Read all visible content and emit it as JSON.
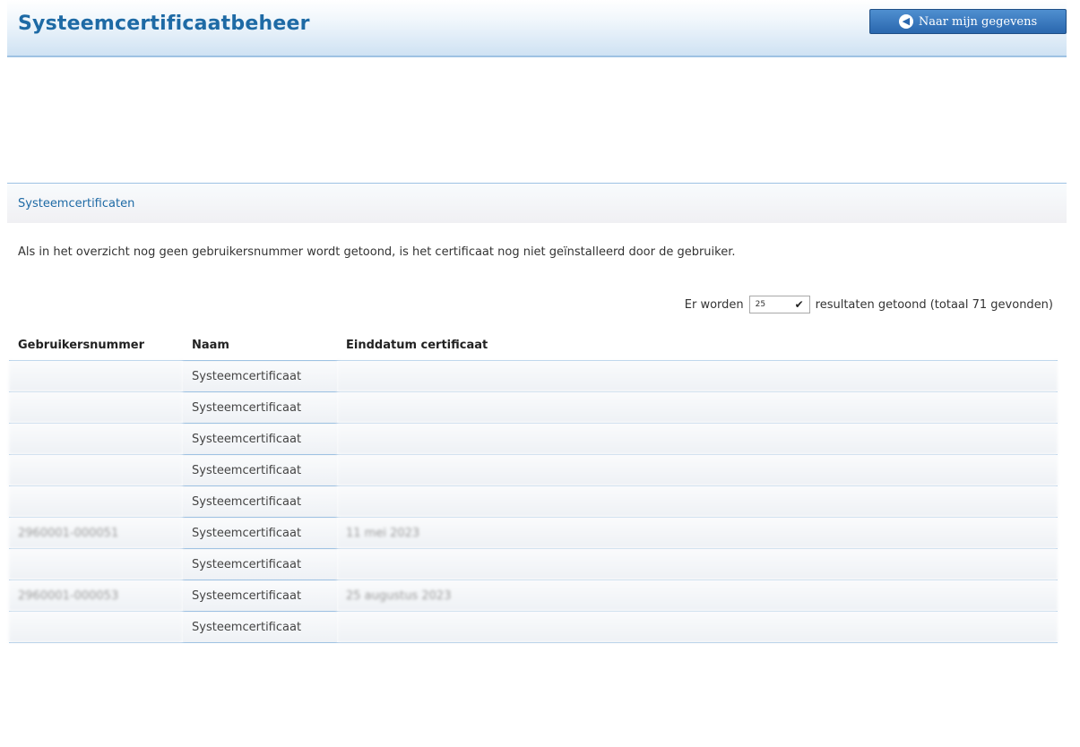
{
  "header": {
    "title": "Systeemcertificaatbeheer",
    "nav_button": "Naar mijn gegevens",
    "accent_color": "#1e6aa5"
  },
  "section": {
    "title": "Systeemcertificaten"
  },
  "info_text": "Als in het overzicht nog geen gebruikersnummer wordt getoond, is het certificaat nog niet geïnstalleerd door de gebruiker.",
  "results": {
    "prefix": "Er worden",
    "page_size": "25",
    "suffix": "resultaten getoond (totaal 71 gevonden)"
  },
  "table": {
    "columns": [
      "Gebruikersnummer",
      "Naam",
      "Einddatum certificaat"
    ],
    "rows": [
      {
        "number": "",
        "name": "Systeemcertificaat",
        "end_date": ""
      },
      {
        "number": "",
        "name": "Systeemcertificaat",
        "end_date": ""
      },
      {
        "number": "",
        "name": "Systeemcertificaat",
        "end_date": ""
      },
      {
        "number": "",
        "name": "Systeemcertificaat",
        "end_date": ""
      },
      {
        "number": "",
        "name": "Systeemcertificaat",
        "end_date": ""
      },
      {
        "number": "2960001-000051",
        "name": "Systeemcertificaat",
        "end_date": "11 mei 2023"
      },
      {
        "number": "",
        "name": "Systeemcertificaat",
        "end_date": ""
      },
      {
        "number": "2960001-000053",
        "name": "Systeemcertificaat",
        "end_date": "25 augustus 2023"
      },
      {
        "number": "",
        "name": "Systeemcertificaat",
        "end_date": ""
      }
    ]
  }
}
